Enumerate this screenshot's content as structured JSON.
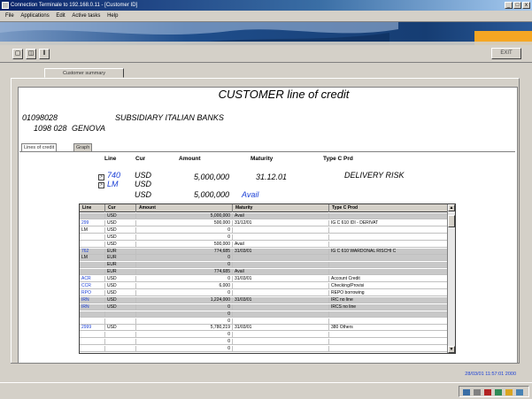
{
  "window": {
    "title": "Connection Terminale to 192.168.0.11 - [Customer ID]",
    "minimize": "_",
    "maximize": "□",
    "close": "x"
  },
  "menu": [
    "File",
    "Applications",
    "Edit",
    "Active tasks",
    "Help"
  ],
  "toolbar": {
    "exit_label": "EXIT"
  },
  "tab": {
    "label": "Customer summary"
  },
  "header": {
    "title": "CUSTOMER line of credit",
    "customer_code": "01098028",
    "customer_name": "SUBSIDIARY ITALIAN BANKS",
    "branch_code": "1098 028",
    "city": "GENOVA"
  },
  "subtabs": [
    "Lines of credit",
    "Graph"
  ],
  "summary": {
    "headers": {
      "line": "Line",
      "cur": "Cur",
      "amount": "Amount",
      "maturity": "Maturity",
      "type": "Type  C  Prd"
    },
    "rows": [
      {
        "line": "740",
        "cur": "USD",
        "amount": "5,000,000",
        "maturity": "31.12.01",
        "type": "DELIVERY RISK"
      },
      {
        "line": "LM",
        "cur": "USD",
        "amount": "",
        "maturity": "",
        "type": ""
      }
    ],
    "total_cur": "USD",
    "total_amount": "5,000,000",
    "total_label": "Avail"
  },
  "grid": {
    "columns": [
      "Line",
      "Cur",
      "Amount",
      "Maturity",
      "Type C Prod"
    ],
    "rows": [
      {
        "line": "",
        "cur": "USD",
        "amount": "5,000,000",
        "maturity": "Avail",
        "type": "",
        "shade": "grey",
        "link": false
      },
      {
        "line": "299",
        "cur": "USD",
        "amount": "500,000",
        "maturity": "31/12/01",
        "type": "IG   C  610   IDI        - DERIVAT",
        "shade": "white",
        "link": true
      },
      {
        "line": "LM",
        "cur": "USD",
        "amount": "0",
        "maturity": "",
        "type": "",
        "shade": "white",
        "link": false
      },
      {
        "line": "",
        "cur": "USD",
        "amount": "0",
        "maturity": "",
        "type": "",
        "shade": "white",
        "link": false
      },
      {
        "line": "",
        "cur": "USD",
        "amount": "500,000",
        "maturity": "Avail",
        "type": "",
        "shade": "white",
        "link": false
      },
      {
        "line": "762",
        "cur": "EUR",
        "amount": "774,685",
        "maturity": "31/03/01",
        "type": "IG   C  610   WARDONAL RISCHI C",
        "shade": "grey",
        "link": true
      },
      {
        "line": "LM",
        "cur": "EUR",
        "amount": "0",
        "maturity": "",
        "type": "",
        "shade": "grey",
        "link": false
      },
      {
        "line": "",
        "cur": "EUR",
        "amount": "0",
        "maturity": "",
        "type": "",
        "shade": "grey",
        "link": false
      },
      {
        "line": "",
        "cur": "EUR",
        "amount": "774,685",
        "maturity": "Avail",
        "type": "",
        "shade": "grey",
        "link": false
      },
      {
        "line": "ACR",
        "cur": "USD",
        "amount": "0",
        "maturity": "31/03/01",
        "type": "Account Credit",
        "shade": "white",
        "link": true
      },
      {
        "line": "CCR",
        "cur": "USD",
        "amount": "6,000",
        "maturity": "",
        "type": "Checking/Provisi",
        "shade": "white",
        "link": true
      },
      {
        "line": "RPO",
        "cur": "USD",
        "amount": "0",
        "maturity": "",
        "type": "REPO borrowing",
        "shade": "white",
        "link": true
      },
      {
        "line": "IRN",
        "cur": "USD",
        "amount": "1,224,000",
        "maturity": "31/03/01",
        "type": "IRC no line",
        "shade": "grey",
        "link": true
      },
      {
        "line": "IRN",
        "cur": "USD",
        "amount": "0",
        "maturity": "",
        "type": "IRCS no line",
        "shade": "grey",
        "link": true
      },
      {
        "line": "",
        "cur": "",
        "amount": "0",
        "maturity": "",
        "type": "",
        "shade": "grey",
        "link": false
      },
      {
        "line": "",
        "cur": "",
        "amount": "0",
        "maturity": "",
        "type": "",
        "shade": "white",
        "link": false
      },
      {
        "line": "2999",
        "cur": "USD",
        "amount": "5,780,219",
        "maturity": "31/03/01",
        "type": "380 Others",
        "shade": "white",
        "link": true
      },
      {
        "line": "",
        "cur": "",
        "amount": "0",
        "maturity": "",
        "type": "",
        "shade": "white",
        "link": false
      },
      {
        "line": "",
        "cur": "",
        "amount": "0",
        "maturity": "",
        "type": "",
        "shade": "white",
        "link": false
      },
      {
        "line": "",
        "cur": "",
        "amount": "0",
        "maturity": "",
        "type": "",
        "shade": "white",
        "link": false
      }
    ]
  },
  "status": {
    "text": "28/03/01 11:57:01 2000"
  },
  "colors": {
    "banner_blue": "#1f4e8c",
    "banner_orange": "#f5a623",
    "link_blue": "#1a3fd6",
    "row_grey": "#c8c8c8"
  }
}
